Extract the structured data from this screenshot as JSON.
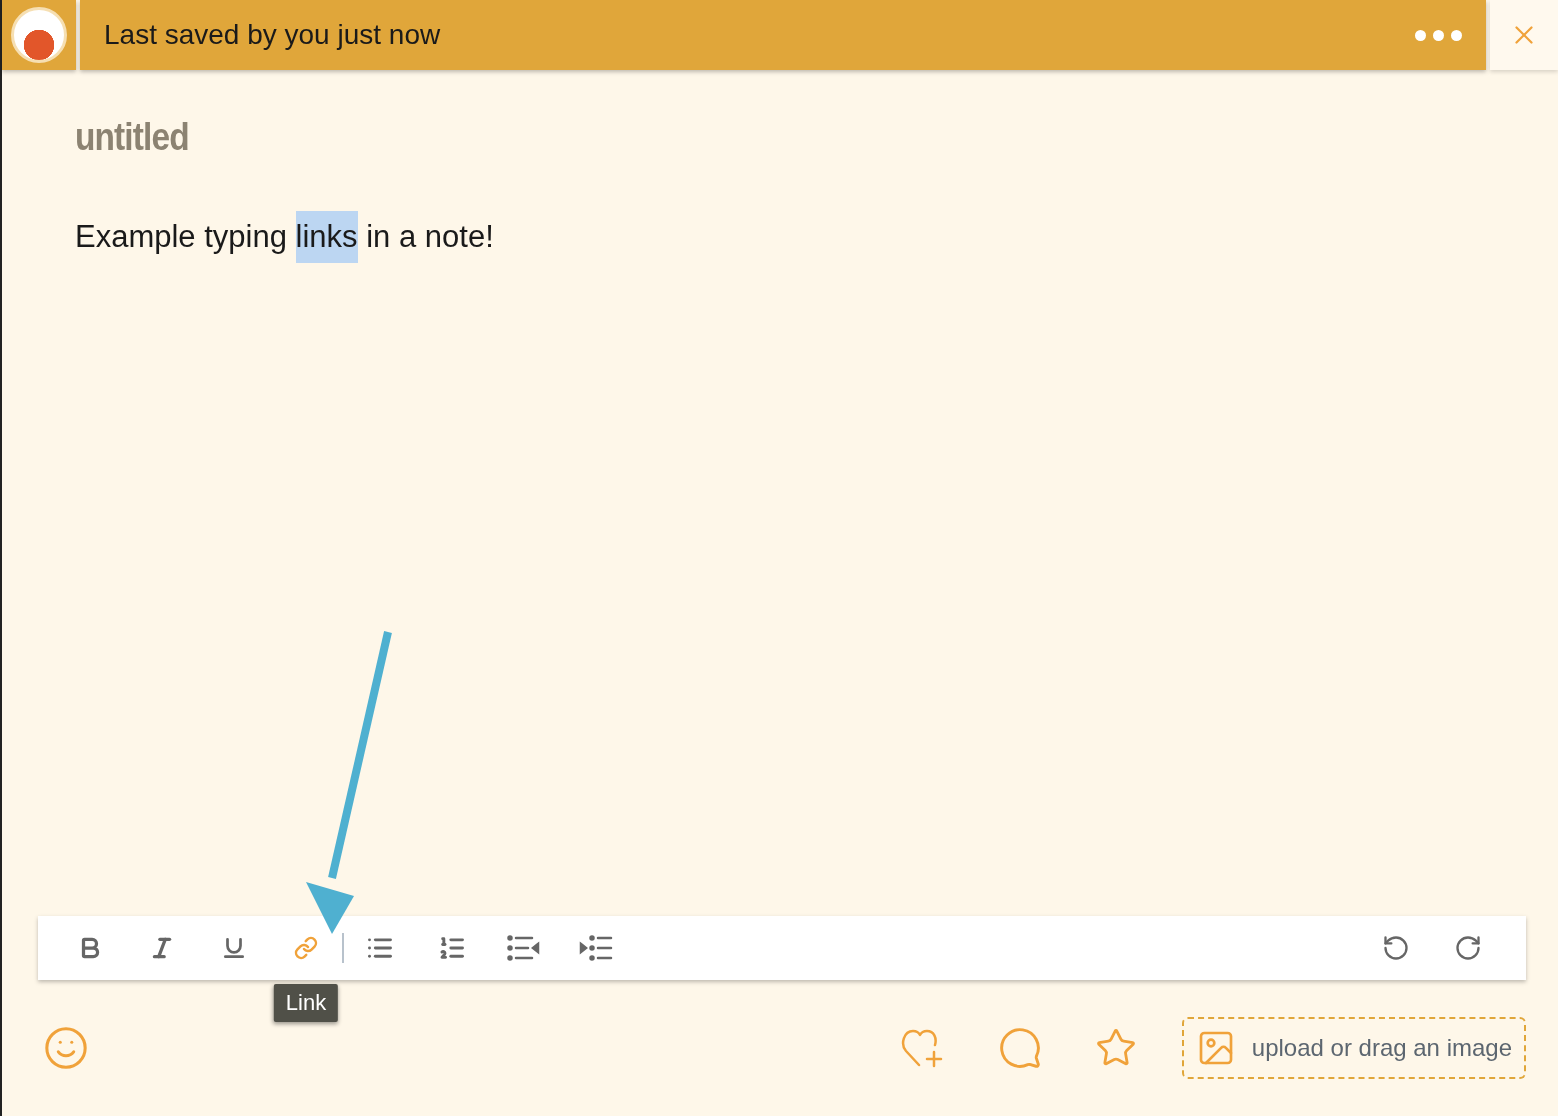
{
  "header": {
    "status": "Last saved by you just now"
  },
  "note": {
    "title": "untitled",
    "body": [
      {
        "text": "Example typing ",
        "selected": false
      },
      {
        "text": "links",
        "selected": true
      },
      {
        "text": " in a note!",
        "selected": false
      }
    ]
  },
  "toolbar": {
    "items": [
      {
        "kind": "bold",
        "active": false
      },
      {
        "kind": "italic",
        "active": false
      },
      {
        "kind": "underline",
        "active": false
      },
      {
        "kind": "link",
        "active": true,
        "tooltip": "Link"
      },
      {
        "kind": "separator"
      },
      {
        "kind": "bullets",
        "active": false
      },
      {
        "kind": "numbers",
        "active": false
      },
      {
        "kind": "outdent",
        "active": false
      },
      {
        "kind": "indent",
        "active": false
      },
      {
        "kind": "spacer"
      },
      {
        "kind": "undo",
        "active": false
      },
      {
        "kind": "redo",
        "active": false
      }
    ]
  },
  "footer": {
    "upload_label": "upload or drag an image"
  }
}
